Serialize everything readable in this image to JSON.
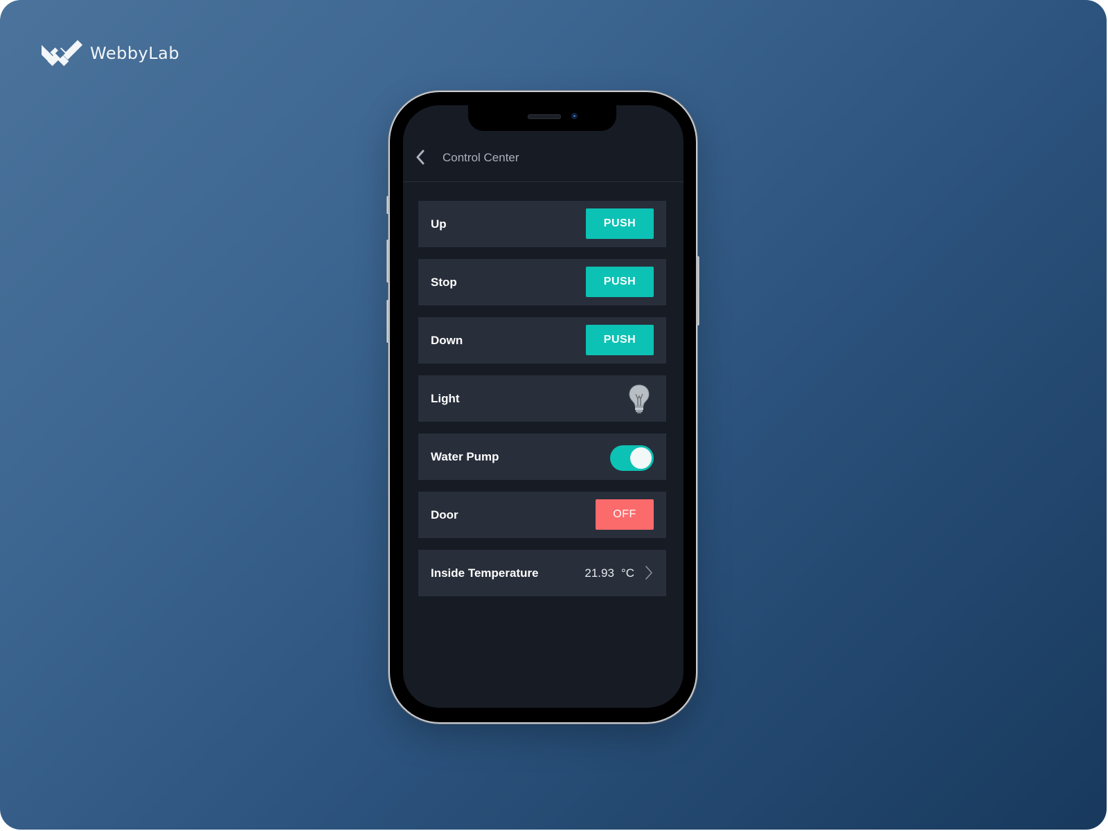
{
  "brand": {
    "name": "WebbyLab",
    "logo_icon": "webbylab-logo-icon"
  },
  "colors": {
    "background_gradient_start": "#4b739b",
    "background_gradient_end": "#18395d",
    "screen_bg": "#161b24",
    "row_bg": "#282e3a",
    "accent_teal": "#0cc2b4",
    "off_red": "#fc6b6c",
    "title_gray": "#aab1bc"
  },
  "app": {
    "title": "Control Center",
    "back_icon": "chevron-left-icon"
  },
  "controls": [
    {
      "label": "Up",
      "type": "push-button",
      "button_label": "PUSH"
    },
    {
      "label": "Stop",
      "type": "push-button",
      "button_label": "PUSH"
    },
    {
      "label": "Down",
      "type": "push-button",
      "button_label": "PUSH"
    },
    {
      "label": "Light",
      "type": "bulb",
      "icon": "lightbulb-icon",
      "state": "off"
    },
    {
      "label": "Water Pump",
      "type": "switch",
      "state": "on"
    },
    {
      "label": "Door",
      "type": "state-button",
      "button_label": "OFF"
    },
    {
      "label": "Inside Temperature",
      "type": "sensor",
      "value": "21.93",
      "unit": "°C",
      "icon": "chevron-right-icon"
    }
  ]
}
